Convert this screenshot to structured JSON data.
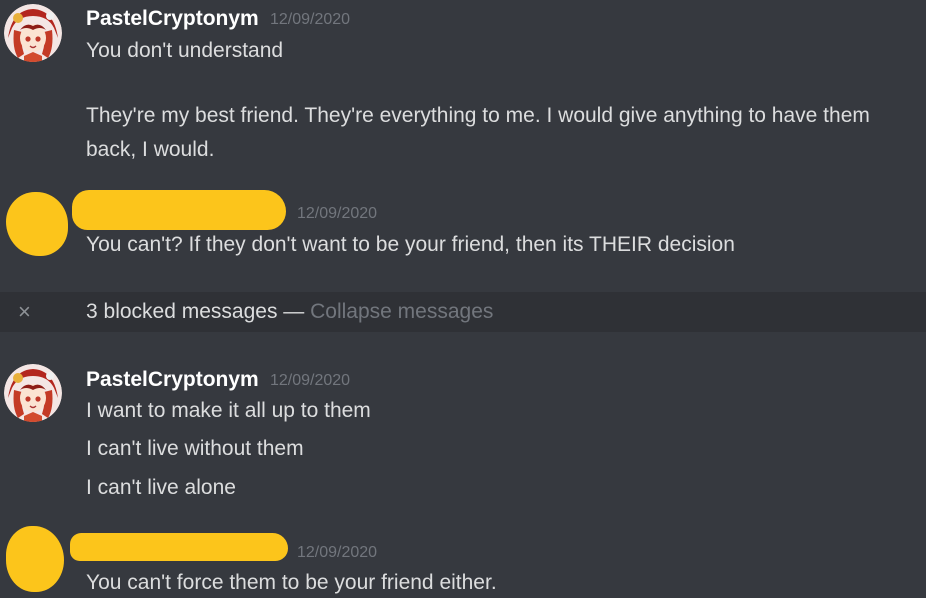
{
  "messages": [
    {
      "author": "PastelCryptonym",
      "timestamp": "12/09/2020",
      "lines": [
        "You don't understand",
        "They're my best friend. They're everything to me. I would give anything to have them",
        "back, I would."
      ]
    },
    {
      "author": "",
      "timestamp": "12/09/2020",
      "lines": [
        "You can't? If they don't want to be your friend, then its THEIR decision"
      ]
    },
    {
      "author": "PastelCryptonym",
      "timestamp": "12/09/2020",
      "lines": [
        "I want to make it all up to them",
        "I can't live without them",
        "I can't live alone"
      ]
    },
    {
      "author": "",
      "timestamp": "12/09/2020",
      "lines": [
        "You can't force them to be your friend either."
      ]
    }
  ],
  "blocked": {
    "close_icon": "×",
    "text": "3 blocked messages — ",
    "collapse_label": "Collapse messages"
  },
  "icons": {
    "close": "close-icon",
    "avatar": "anime-avatar",
    "redaction": "redaction-scribble"
  },
  "colors": {
    "background": "#36393f",
    "blocked_bar": "#2f3136",
    "username": "#ffffff",
    "message_text": "#dcddde",
    "timestamp": "#72767d",
    "redaction": "#fcc51b"
  }
}
